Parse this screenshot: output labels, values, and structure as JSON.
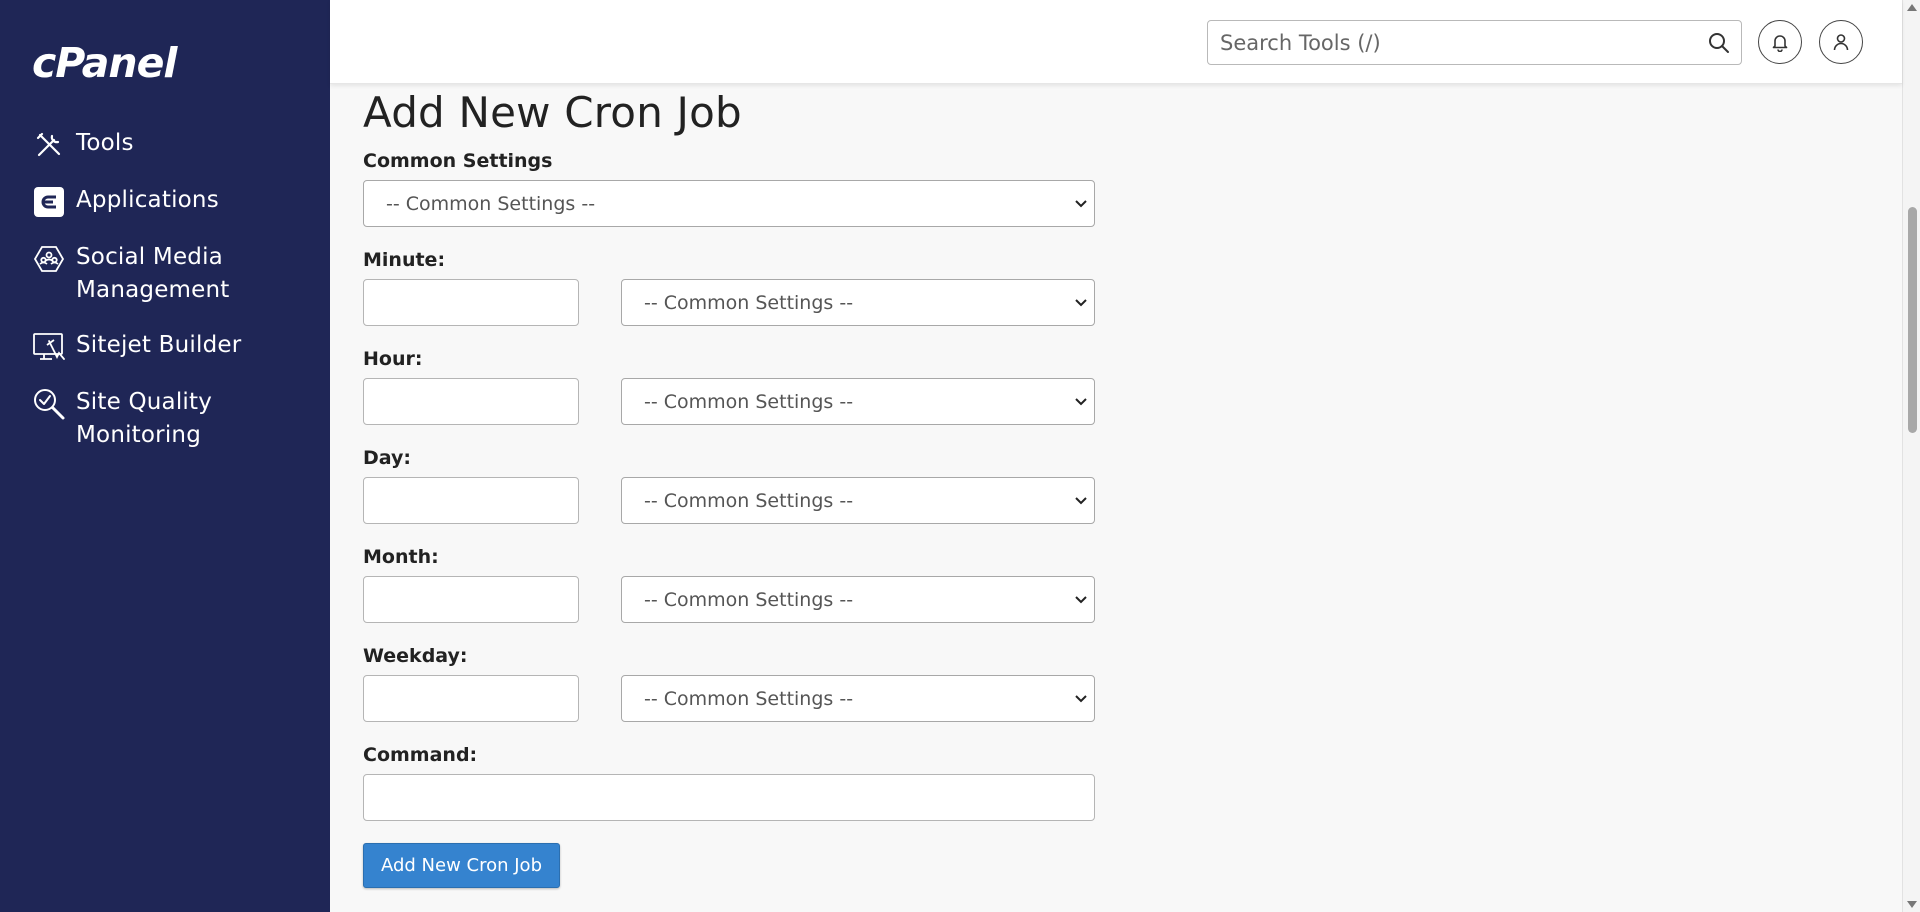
{
  "sidebar": {
    "brand": "cPanel",
    "items": [
      {
        "label": "Tools",
        "icon": "tools-icon"
      },
      {
        "label": "Applications",
        "icon": "applications-icon"
      },
      {
        "label": "Social Media Management",
        "icon": "social-media-icon"
      },
      {
        "label": "Sitejet Builder",
        "icon": "sitejet-icon"
      },
      {
        "label": "Site Quality Monitoring",
        "icon": "site-quality-icon"
      }
    ]
  },
  "header": {
    "search_placeholder": "Search Tools (/)"
  },
  "form": {
    "title": "Add New Cron Job",
    "common_settings_label": "Common Settings",
    "common_settings_value": "-- Common Settings --",
    "minute_label": "Minute:",
    "hour_label": "Hour:",
    "day_label": "Day:",
    "month_label": "Month:",
    "weekday_label": "Weekday:",
    "command_label": "Command:",
    "select_default": "-- Common Settings --",
    "minute_value": "",
    "hour_value": "",
    "day_value": "",
    "month_value": "",
    "weekday_value": "",
    "command_value": "",
    "submit_label": "Add New Cron Job"
  },
  "colors": {
    "sidebar_bg": "#1f2656",
    "primary_button": "#3583cf",
    "page_bg": "#f8f8f8"
  }
}
